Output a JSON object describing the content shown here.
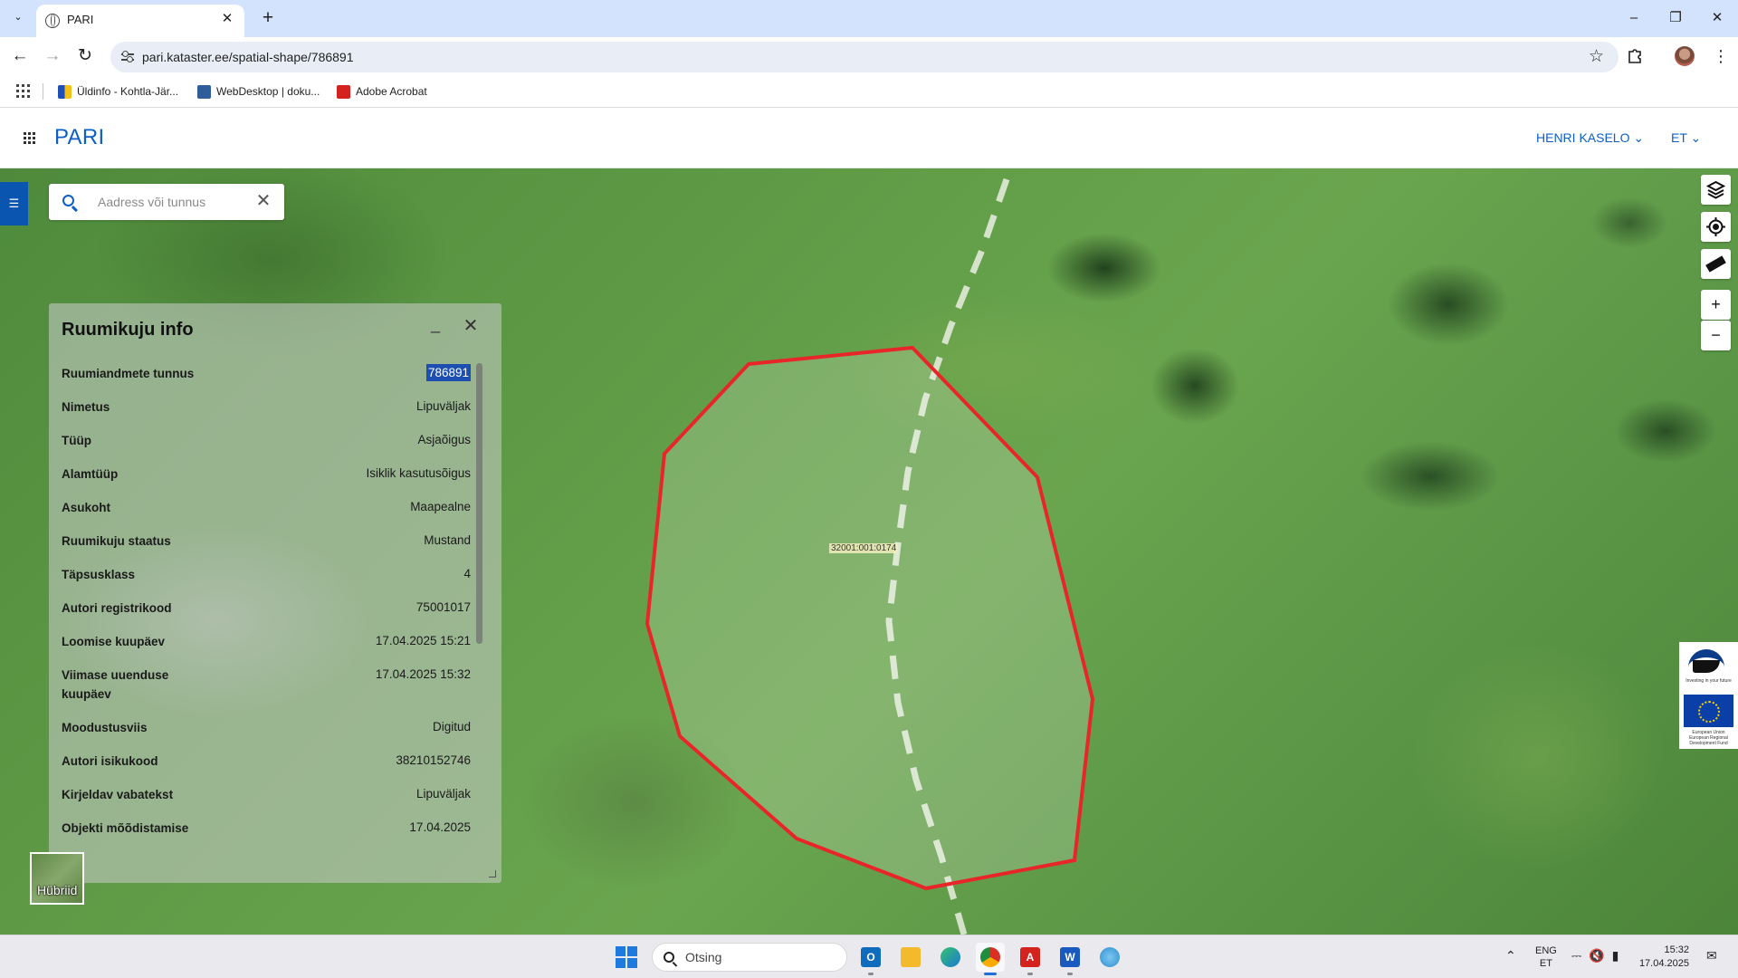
{
  "browser": {
    "tab_title": "PARI",
    "url": "pari.kataster.ee/spatial-shape/786891",
    "bookmarks": [
      {
        "label": "Üldinfo - Kohtla-Jär..."
      },
      {
        "label": "WebDesktop | doku..."
      },
      {
        "label": "Adobe Acrobat"
      }
    ]
  },
  "app": {
    "title": "PARI",
    "user_name": "HENRI KASELO",
    "language": "ET"
  },
  "search": {
    "placeholder": "Aadress või tunnus"
  },
  "info_panel": {
    "title": "Ruumikuju info",
    "rows": [
      {
        "label": "Ruumiandmete tunnus",
        "value": "786891"
      },
      {
        "label": "Nimetus",
        "value": "Lipuväljak"
      },
      {
        "label": "Tüüp",
        "value": "Asjaõigus"
      },
      {
        "label": "Alamtüüp",
        "value": "Isiklik kasutusõigus"
      },
      {
        "label": "Asukoht",
        "value": "Maapealne"
      },
      {
        "label": "Ruumikuju staatus",
        "value": "Mustand"
      },
      {
        "label": "Täpsusklass",
        "value": "4"
      },
      {
        "label": "Autori registrikood",
        "value": "75001017"
      },
      {
        "label": "Loomise kuupäev",
        "value": "17.04.2025 15:21"
      },
      {
        "label": "Viimase uuenduse kuupäev",
        "value": "17.04.2025 15:32"
      },
      {
        "label": "Moodustusviis",
        "value": "Digitud"
      },
      {
        "label": "Autori isikukood",
        "value": "38210152746"
      },
      {
        "label": "Kirjeldav vabatekst",
        "value": "Lipuväljak"
      },
      {
        "label": "Objekti mõõdistamise",
        "value": "17.04.2025"
      }
    ]
  },
  "map": {
    "parcel_label": "32001:001:0174",
    "layer_switcher_label": "Hübriid",
    "polygon_color": "#e8262a",
    "controls": {
      "zoom_in": "+",
      "zoom_out": "−"
    }
  },
  "eu_logo": {
    "slogan": "Investing in your future",
    "fund_text": "European Union European Regional Development Fund"
  },
  "taskbar": {
    "search_label": "Otsing",
    "lang_primary": "ENG",
    "lang_secondary": "ET",
    "time": "15:32",
    "date": "17.04.2025"
  }
}
